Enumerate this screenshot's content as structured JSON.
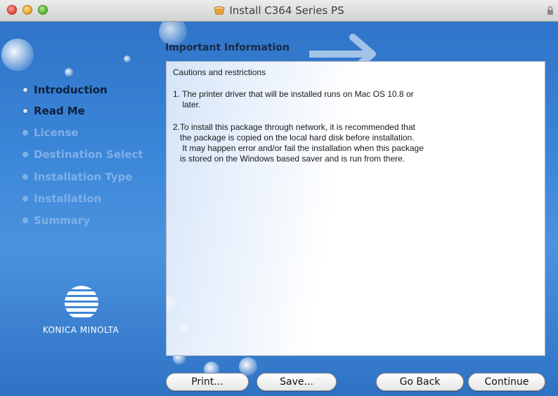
{
  "window": {
    "title": "Install C364 Series PS"
  },
  "sidebar": {
    "steps": [
      {
        "label": "Introduction",
        "state": "done"
      },
      {
        "label": "Read Me",
        "state": "current"
      },
      {
        "label": "License",
        "state": "future"
      },
      {
        "label": "Destination Select",
        "state": "future"
      },
      {
        "label": "Installation Type",
        "state": "future"
      },
      {
        "label": "Installation",
        "state": "future"
      },
      {
        "label": "Summary",
        "state": "future"
      }
    ],
    "brand": "KONICA MINOLTA"
  },
  "main": {
    "header": "Important Information",
    "lines": [
      "Cautions and restrictions",
      "1. The printer driver that will be installed runs on Mac OS 10.8 or",
      "    later.",
      "2.To install this package through network, it is recommended that",
      "   the package is copied on the local hard disk before installation.",
      "    It may happen error and/or fail the installation when this package",
      "   is stored on the Windows based saver and is run from there."
    ]
  },
  "buttons": {
    "print": "Print...",
    "save": "Save...",
    "go_back": "Go Back",
    "continue": "Continue"
  },
  "colors": {
    "sidebar_blue": "#2f74c8",
    "current_step": "#0f1f3d",
    "future_step": "#7fb0e6"
  }
}
